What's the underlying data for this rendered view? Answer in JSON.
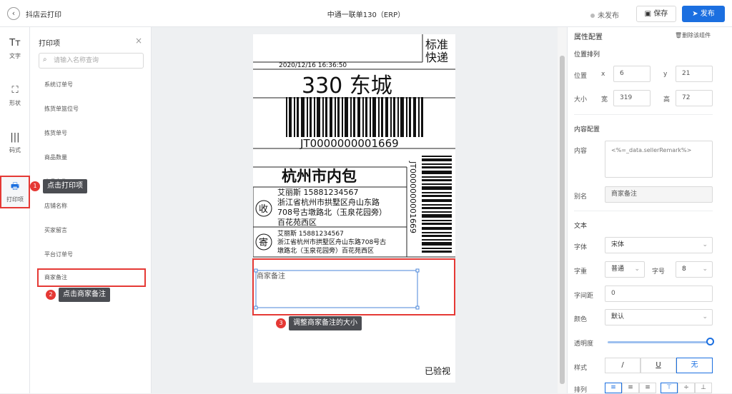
{
  "header": {
    "back_icon": "chevron-left-icon",
    "app_title": "抖店云打印",
    "doc_title": "中通一联单130（ERP）",
    "status": "未发布",
    "save": "保存",
    "publish": "发布"
  },
  "toolbar": {
    "items": [
      {
        "icon": "Tт",
        "label": "文字"
      },
      {
        "icon": "⛶",
        "label": "形状"
      },
      {
        "icon": "|||",
        "label": "码式"
      },
      {
        "icon": "🖶",
        "label": "打印项"
      }
    ]
  },
  "panel": {
    "title": "打印项",
    "close": "×",
    "search_placeholder": "请输入名称查询",
    "items": [
      "系统订单号",
      "拣货单篮位号",
      "拣货单号",
      "商品数量",
      "商品名称",
      "店铺名称",
      "买家留言",
      "平台订单号",
      "商家备注"
    ]
  },
  "callouts": [
    {
      "num": "1",
      "text": "点击打印项"
    },
    {
      "num": "2",
      "text": "点击商家备注"
    },
    {
      "num": "3",
      "text": "调整商家备注的大小"
    }
  ],
  "label": {
    "brand": [
      "标准",
      "快递"
    ],
    "datetime": "2020/12/16 16:36:50",
    "route": "330 东城",
    "tracking": "JT0000000001669",
    "hub": "杭州市内包",
    "recipient_badge": "收",
    "recipient_name_phone": "艾丽斯 15881234567",
    "recipient_addr": [
      "浙江省杭州市拱墅区舟山东路",
      "708号古墩路北（玉泉花园旁）",
      "百花苑西区"
    ],
    "sender_badge": "寄",
    "sender_name_phone": "艾丽斯 15881234567",
    "sender_addr": [
      "浙江省杭州市拱墅区舟山东路708号古",
      "墩路北（玉泉花园旁）百花苑西区"
    ],
    "remark_field": "商家备注",
    "footer": "已验视"
  },
  "props": {
    "title": "属性配置",
    "delete": "删除该组件",
    "position_section": "位置排列",
    "position_label": "位置",
    "x_label": "x",
    "x": "6",
    "y_label": "y",
    "y": "21",
    "size_label": "大小",
    "width_label": "宽",
    "width": "319",
    "height_label": "高",
    "height": "72",
    "content_section": "内容配置",
    "content_label": "内容",
    "content": "<%=_data.sellerRemark%>",
    "alias_label": "别名",
    "alias": "商家备注",
    "text_section": "文本",
    "font_label": "字体",
    "font": "宋体",
    "weight_label": "字重",
    "weight": "普通",
    "size_field_label": "字号",
    "font_size": "8",
    "spacing_label": "字间距",
    "spacing": "0",
    "color_label": "颜色",
    "color": "默认",
    "opacity_label": "透明度",
    "opacity": 1.0,
    "style_label": "样式",
    "style_options": [
      "/",
      "U",
      "无"
    ],
    "align_label": "排列",
    "align_icons": [
      "align-left-icon",
      "align-center-icon",
      "align-right-icon",
      "align-top-icon",
      "align-middle-icon",
      "align-bottom-icon"
    ]
  },
  "colors": {
    "accent": "#1b6fe0",
    "highlight": "#e53935",
    "callout": "#4b4d52"
  }
}
